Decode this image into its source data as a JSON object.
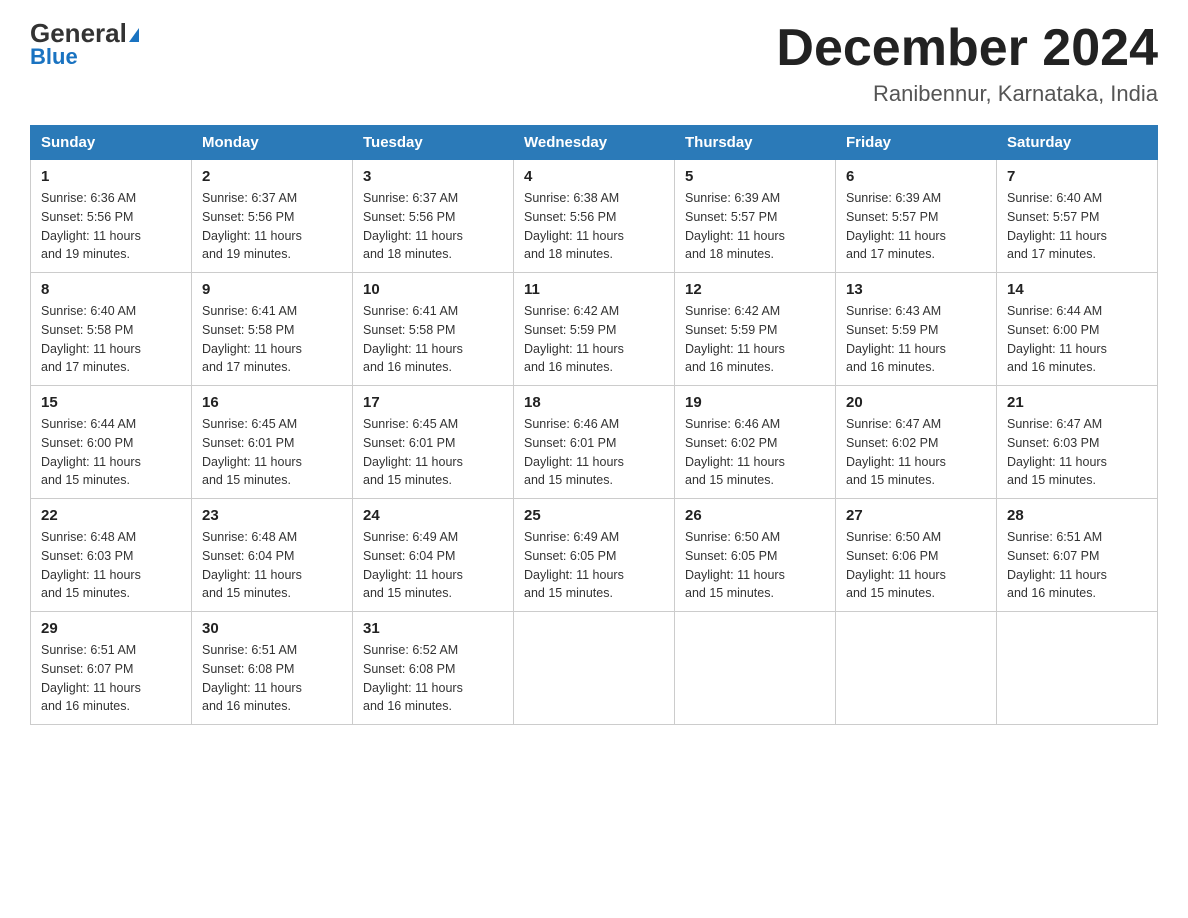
{
  "header": {
    "logo_general": "General",
    "logo_blue": "Blue",
    "month_title": "December 2024",
    "location": "Ranibennur, Karnataka, India"
  },
  "days_of_week": [
    "Sunday",
    "Monday",
    "Tuesday",
    "Wednesday",
    "Thursday",
    "Friday",
    "Saturday"
  ],
  "weeks": [
    [
      {
        "day": "1",
        "sunrise": "6:36 AM",
        "sunset": "5:56 PM",
        "daylight": "11 hours and 19 minutes."
      },
      {
        "day": "2",
        "sunrise": "6:37 AM",
        "sunset": "5:56 PM",
        "daylight": "11 hours and 19 minutes."
      },
      {
        "day": "3",
        "sunrise": "6:37 AM",
        "sunset": "5:56 PM",
        "daylight": "11 hours and 18 minutes."
      },
      {
        "day": "4",
        "sunrise": "6:38 AM",
        "sunset": "5:56 PM",
        "daylight": "11 hours and 18 minutes."
      },
      {
        "day": "5",
        "sunrise": "6:39 AM",
        "sunset": "5:57 PM",
        "daylight": "11 hours and 18 minutes."
      },
      {
        "day": "6",
        "sunrise": "6:39 AM",
        "sunset": "5:57 PM",
        "daylight": "11 hours and 17 minutes."
      },
      {
        "day": "7",
        "sunrise": "6:40 AM",
        "sunset": "5:57 PM",
        "daylight": "11 hours and 17 minutes."
      }
    ],
    [
      {
        "day": "8",
        "sunrise": "6:40 AM",
        "sunset": "5:58 PM",
        "daylight": "11 hours and 17 minutes."
      },
      {
        "day": "9",
        "sunrise": "6:41 AM",
        "sunset": "5:58 PM",
        "daylight": "11 hours and 17 minutes."
      },
      {
        "day": "10",
        "sunrise": "6:41 AM",
        "sunset": "5:58 PM",
        "daylight": "11 hours and 16 minutes."
      },
      {
        "day": "11",
        "sunrise": "6:42 AM",
        "sunset": "5:59 PM",
        "daylight": "11 hours and 16 minutes."
      },
      {
        "day": "12",
        "sunrise": "6:42 AM",
        "sunset": "5:59 PM",
        "daylight": "11 hours and 16 minutes."
      },
      {
        "day": "13",
        "sunrise": "6:43 AM",
        "sunset": "5:59 PM",
        "daylight": "11 hours and 16 minutes."
      },
      {
        "day": "14",
        "sunrise": "6:44 AM",
        "sunset": "6:00 PM",
        "daylight": "11 hours and 16 minutes."
      }
    ],
    [
      {
        "day": "15",
        "sunrise": "6:44 AM",
        "sunset": "6:00 PM",
        "daylight": "11 hours and 15 minutes."
      },
      {
        "day": "16",
        "sunrise": "6:45 AM",
        "sunset": "6:01 PM",
        "daylight": "11 hours and 15 minutes."
      },
      {
        "day": "17",
        "sunrise": "6:45 AM",
        "sunset": "6:01 PM",
        "daylight": "11 hours and 15 minutes."
      },
      {
        "day": "18",
        "sunrise": "6:46 AM",
        "sunset": "6:01 PM",
        "daylight": "11 hours and 15 minutes."
      },
      {
        "day": "19",
        "sunrise": "6:46 AM",
        "sunset": "6:02 PM",
        "daylight": "11 hours and 15 minutes."
      },
      {
        "day": "20",
        "sunrise": "6:47 AM",
        "sunset": "6:02 PM",
        "daylight": "11 hours and 15 minutes."
      },
      {
        "day": "21",
        "sunrise": "6:47 AM",
        "sunset": "6:03 PM",
        "daylight": "11 hours and 15 minutes."
      }
    ],
    [
      {
        "day": "22",
        "sunrise": "6:48 AM",
        "sunset": "6:03 PM",
        "daylight": "11 hours and 15 minutes."
      },
      {
        "day": "23",
        "sunrise": "6:48 AM",
        "sunset": "6:04 PM",
        "daylight": "11 hours and 15 minutes."
      },
      {
        "day": "24",
        "sunrise": "6:49 AM",
        "sunset": "6:04 PM",
        "daylight": "11 hours and 15 minutes."
      },
      {
        "day": "25",
        "sunrise": "6:49 AM",
        "sunset": "6:05 PM",
        "daylight": "11 hours and 15 minutes."
      },
      {
        "day": "26",
        "sunrise": "6:50 AM",
        "sunset": "6:05 PM",
        "daylight": "11 hours and 15 minutes."
      },
      {
        "day": "27",
        "sunrise": "6:50 AM",
        "sunset": "6:06 PM",
        "daylight": "11 hours and 15 minutes."
      },
      {
        "day": "28",
        "sunrise": "6:51 AM",
        "sunset": "6:07 PM",
        "daylight": "11 hours and 16 minutes."
      }
    ],
    [
      {
        "day": "29",
        "sunrise": "6:51 AM",
        "sunset": "6:07 PM",
        "daylight": "11 hours and 16 minutes."
      },
      {
        "day": "30",
        "sunrise": "6:51 AM",
        "sunset": "6:08 PM",
        "daylight": "11 hours and 16 minutes."
      },
      {
        "day": "31",
        "sunrise": "6:52 AM",
        "sunset": "6:08 PM",
        "daylight": "11 hours and 16 minutes."
      },
      null,
      null,
      null,
      null
    ]
  ],
  "labels": {
    "sunrise": "Sunrise:",
    "sunset": "Sunset:",
    "daylight": "Daylight:"
  }
}
